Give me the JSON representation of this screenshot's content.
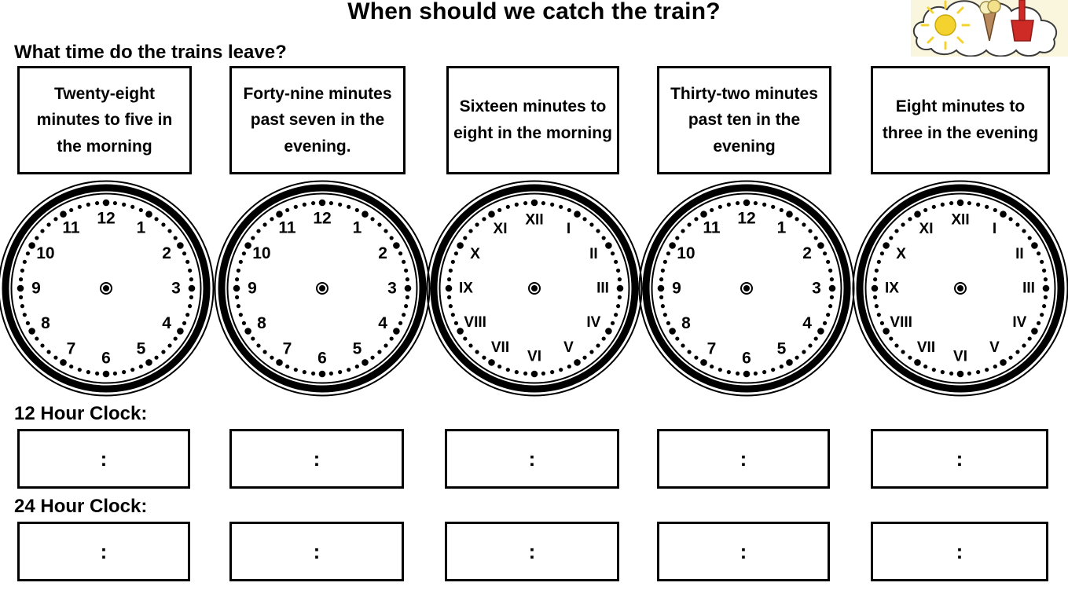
{
  "title": "When should we catch the train?",
  "prompt": "What time do the trains leave?",
  "labels": {
    "twelve_hour": "12 Hour Clock:",
    "twenty_four_hour": "24 Hour Clock:"
  },
  "answer_separator": ":",
  "colors": {
    "ink": "#000000",
    "page": "#ffffff",
    "art_background": "#faf6de",
    "sun": "#f5d32e",
    "spade": "#cf2b26",
    "cone": "#b98a5e",
    "ice_cream": "#f7f0c0"
  },
  "corner_art": {
    "name": "holiday-cloud-illustration",
    "elements": [
      "cloud",
      "sun",
      "ice-cream-cone",
      "spade"
    ]
  },
  "columns": [
    {
      "index": 1,
      "time_text": "Twenty-eight minutes to five in the morning",
      "clock": {
        "numeral_style": "arabic",
        "numerals": [
          "12",
          "1",
          "2",
          "3",
          "4",
          "5",
          "6",
          "7",
          "8",
          "9",
          "10",
          "11"
        ],
        "hands": "none"
      },
      "twelve_hour_answer": "",
      "twenty_four_hour_answer": ""
    },
    {
      "index": 2,
      "time_text": "Forty-nine minutes past seven in the evening.",
      "clock": {
        "numeral_style": "arabic",
        "numerals": [
          "12",
          "1",
          "2",
          "3",
          "4",
          "5",
          "6",
          "7",
          "8",
          "9",
          "10",
          "11"
        ],
        "hands": "none"
      },
      "twelve_hour_answer": "",
      "twenty_four_hour_answer": ""
    },
    {
      "index": 3,
      "time_text": "Sixteen minutes to eight in the morning",
      "clock": {
        "numeral_style": "roman",
        "numerals": [
          "XII",
          "I",
          "II",
          "III",
          "IV",
          "V",
          "VI",
          "VII",
          "VIII",
          "IX",
          "X",
          "XI"
        ],
        "hands": "none"
      },
      "twelve_hour_answer": "",
      "twenty_four_hour_answer": ""
    },
    {
      "index": 4,
      "time_text": "Thirty-two minutes past ten in the evening",
      "clock": {
        "numeral_style": "arabic",
        "numerals": [
          "12",
          "1",
          "2",
          "3",
          "4",
          "5",
          "6",
          "7",
          "8",
          "9",
          "10",
          "11"
        ],
        "hands": "none"
      },
      "twelve_hour_answer": "",
      "twenty_four_hour_answer": ""
    },
    {
      "index": 5,
      "time_text": "Eight minutes to three in the evening",
      "clock": {
        "numeral_style": "roman",
        "numerals": [
          "XII",
          "I",
          "II",
          "III",
          "IV",
          "V",
          "VI",
          "VII",
          "VIII",
          "IX",
          "X",
          "XI"
        ],
        "hands": "none"
      },
      "twelve_hour_answer": "",
      "twenty_four_hour_answer": ""
    }
  ]
}
